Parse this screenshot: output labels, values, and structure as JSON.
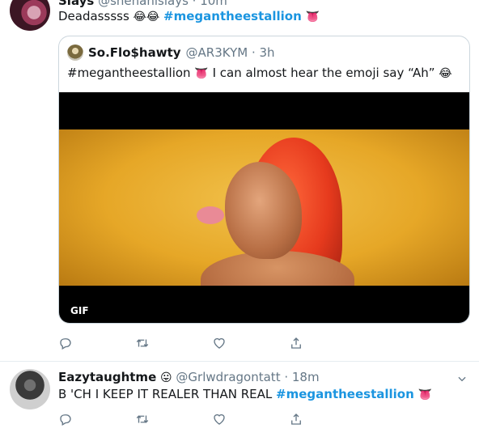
{
  "tweet1": {
    "display_name": "Slays",
    "handle_time": "@shehanislays · 10m",
    "text": "Deadasssss",
    "text_emoji": "😂😂",
    "hashtag": "#megantheestallion",
    "hashtag_emoji": "👅",
    "quoted": {
      "display_name": "So.Flo$hawty",
      "handle_time": "@AR3KYM · 3h",
      "hashtag": "#megantheestallion",
      "hashtag_emoji": "👅",
      "text": " I can almost hear the emoji say  “Ah” ",
      "text_emoji": "😂",
      "media_badge": "GIF"
    }
  },
  "tweet2": {
    "display_name": "Eazytaughtme",
    "name_emoji": "😛",
    "handle_time": "@Grlwdragontatt · 18m",
    "text": "B  'CH I KEEP IT REALER THAN REAL ",
    "hashtag": "#megantheestallion",
    "hashtag_emoji": "👅"
  },
  "icons": {
    "reply": "reply-icon",
    "retweet": "retweet-icon",
    "like": "heart-icon",
    "share": "share-icon",
    "more": "chevron-down-icon"
  },
  "colors": {
    "link": "#1b95e0",
    "meta_text": "#657786",
    "border": "#ccd6dd"
  }
}
